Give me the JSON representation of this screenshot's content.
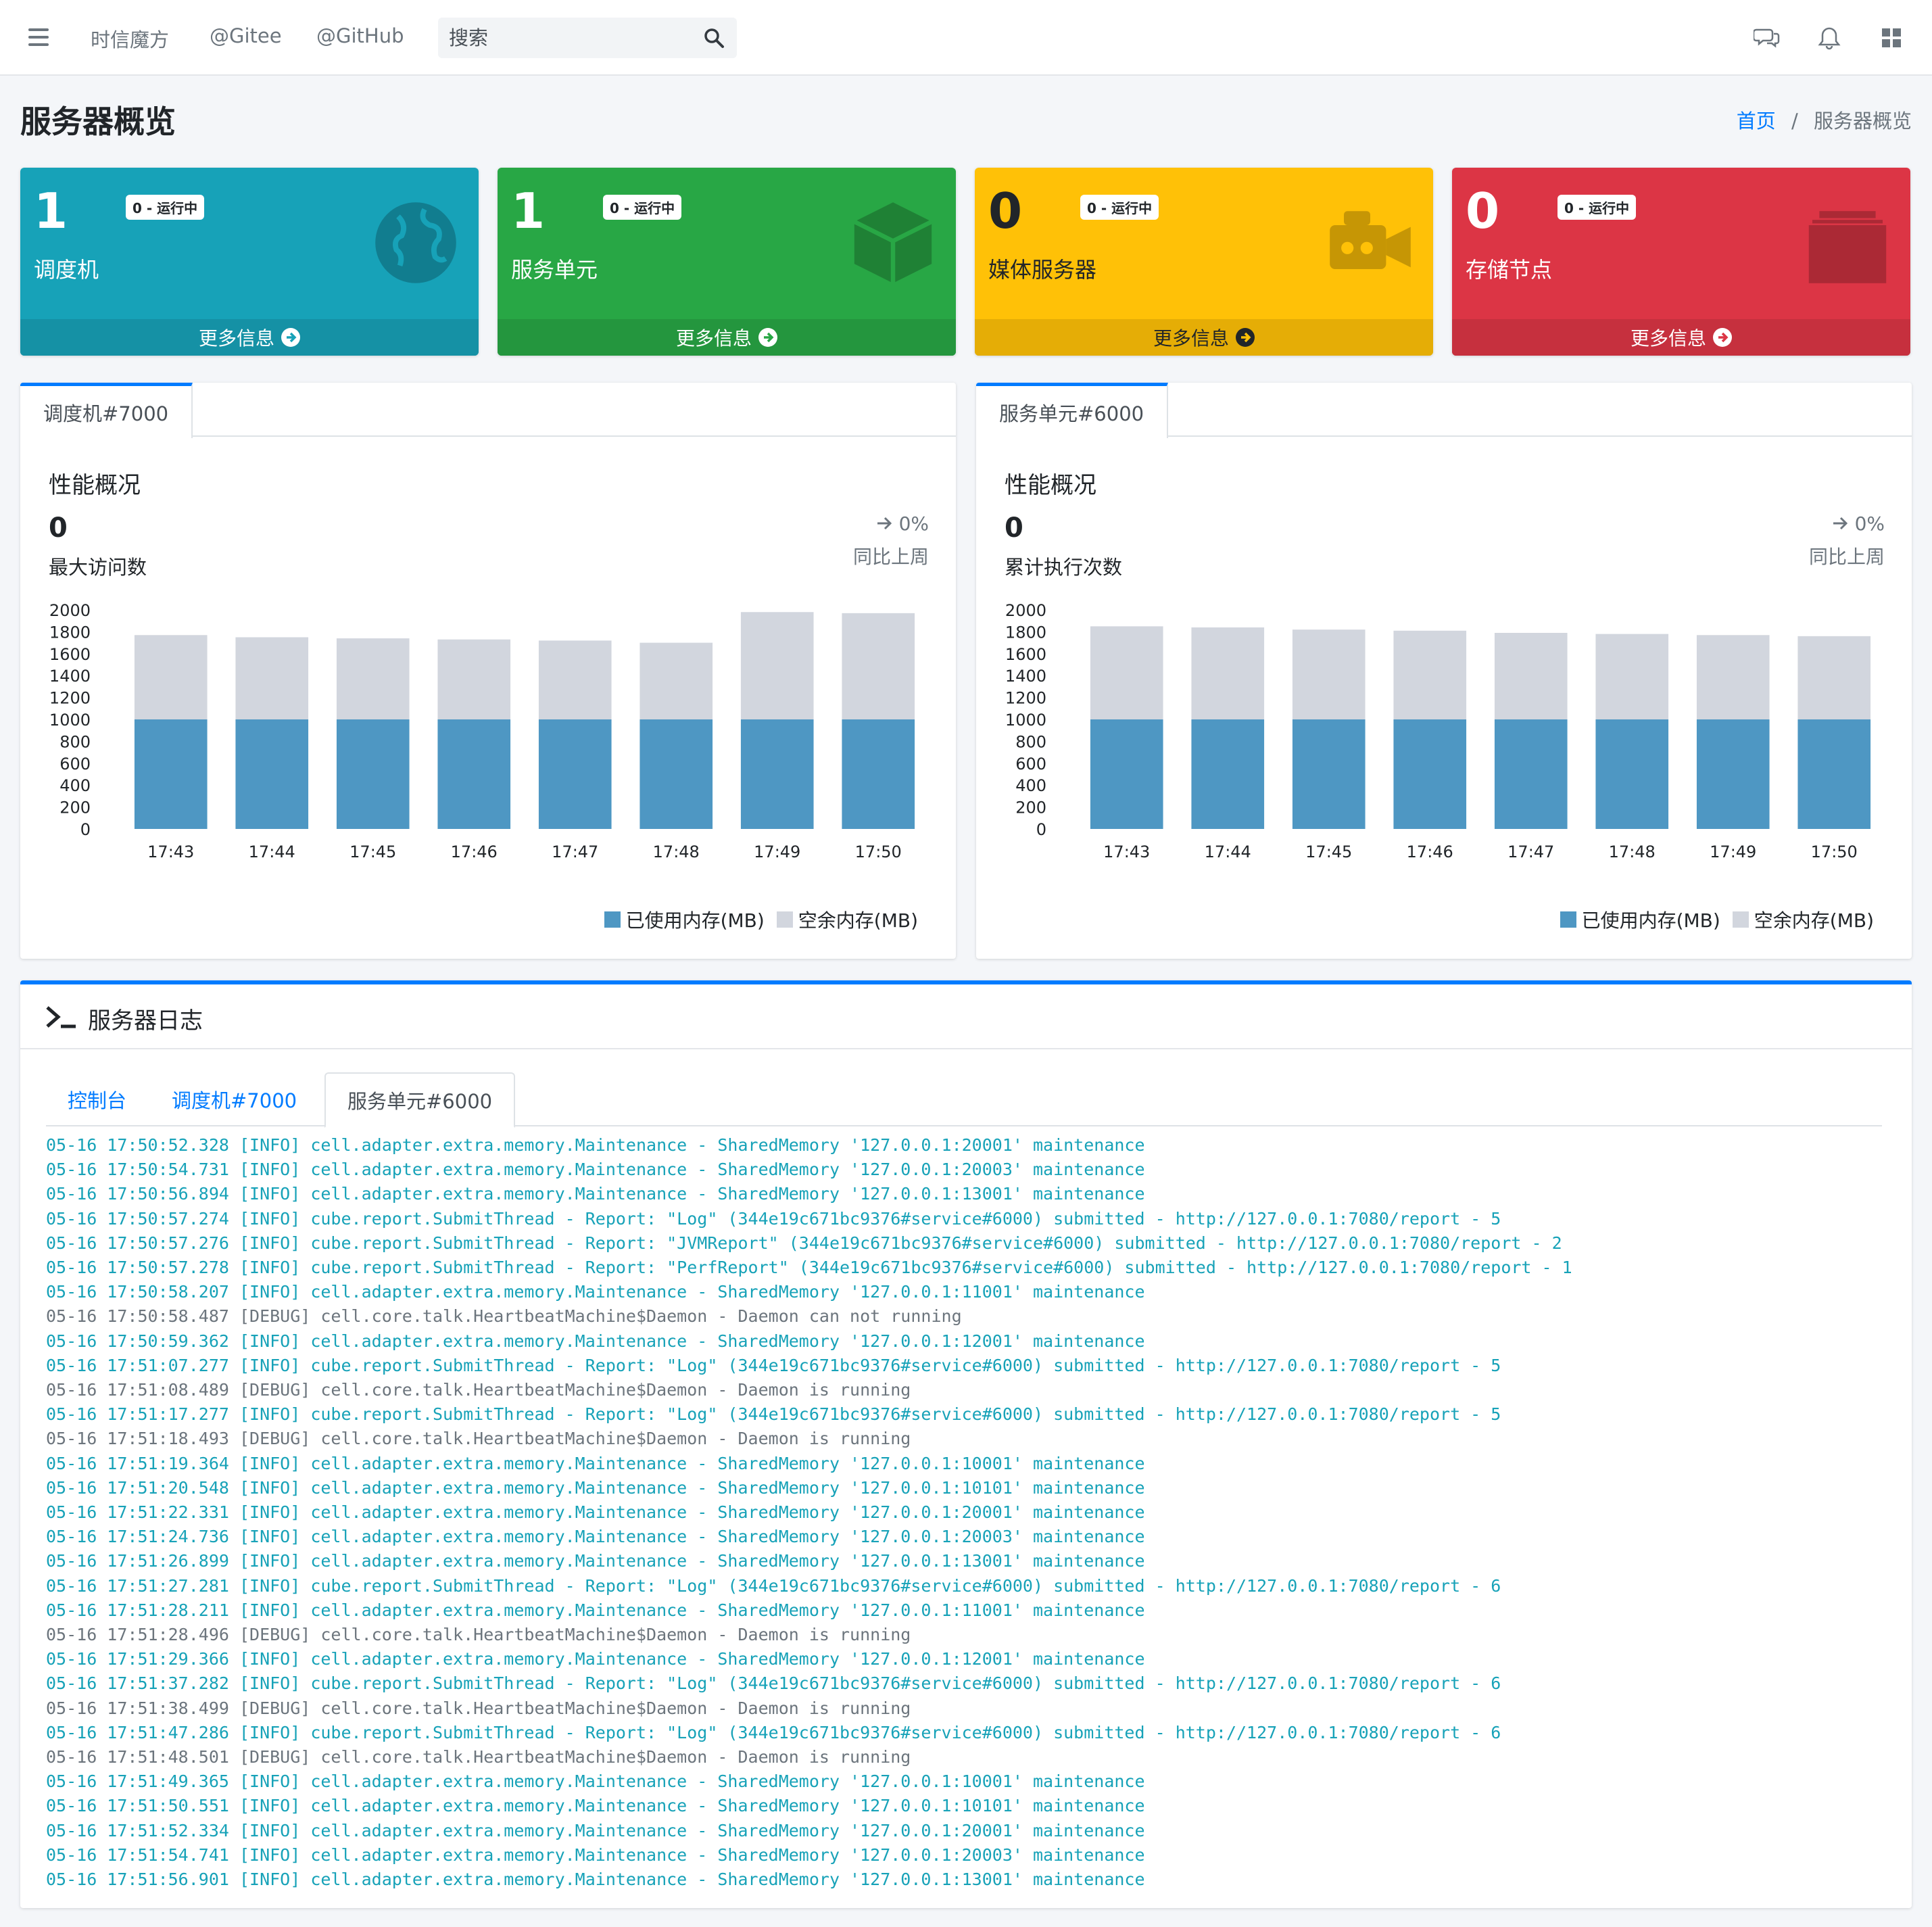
{
  "navbar": {
    "links": [
      "时信魔方",
      "@Gitee",
      "@GitHub"
    ],
    "search_placeholder": "搜索",
    "icons": [
      "menu-icon",
      "search-icon",
      "chat-icon",
      "bell-icon",
      "apps-grid-icon"
    ]
  },
  "page": {
    "title": "服务器概览",
    "breadcrumb": [
      "首页",
      "/",
      "服务器概览"
    ]
  },
  "stats": [
    {
      "count": "1",
      "badge": "0 - 运行中",
      "label": "调度机",
      "footer": "更多信息",
      "color": "#17a2b8",
      "footer_color": "#1591a5",
      "icon": "globe-icon"
    },
    {
      "count": "1",
      "badge": "0 - 运行中",
      "label": "服务单元",
      "footer": "更多信息",
      "color": "#28a745",
      "footer_color": "#24963e",
      "icon": "cube-icon"
    },
    {
      "count": "0",
      "badge": "0 - 运行中",
      "label": "媒体服务器",
      "footer": "更多信息",
      "color": "#ffc107",
      "footer_color": "#e5ad06",
      "icon": "video-camera-icon"
    },
    {
      "count": "0",
      "badge": "0 - 运行中",
      "label": "存储节点",
      "footer": "更多信息",
      "color": "#dc3545",
      "footer_color": "#c6303e",
      "icon": "archive-icon"
    }
  ],
  "panels": [
    {
      "tab": "调度机#7000",
      "title": "性能概况",
      "value": "0",
      "value_label": "最大访问数",
      "change": "0%",
      "change_label": "同比上周"
    },
    {
      "tab": "服务单元#6000",
      "title": "性能概况",
      "value": "0",
      "value_label": "累计执行次数",
      "change": "0%",
      "change_label": "同比上周"
    }
  ],
  "chart_data": [
    {
      "type": "bar",
      "stacked": true,
      "categories": [
        "17:43",
        "17:44",
        "17:45",
        "17:46",
        "17:47",
        "17:48",
        "17:49",
        "17:50"
      ],
      "series": [
        {
          "name": "已使用内存(MB)",
          "color": "#4e97c3",
          "values": [
            1000,
            1000,
            1000,
            1000,
            1000,
            1000,
            1000,
            1000
          ]
        },
        {
          "name": "空余内存(MB)",
          "color": "#d2d6de",
          "values": [
            770,
            750,
            740,
            730,
            720,
            700,
            980,
            970
          ]
        }
      ],
      "ylim": [
        0,
        2000
      ],
      "yticks": [
        0,
        200,
        400,
        600,
        800,
        1000,
        1200,
        1400,
        1600,
        1800,
        2000
      ],
      "legend": "bottom-right"
    },
    {
      "type": "bar",
      "stacked": true,
      "categories": [
        "17:43",
        "17:44",
        "17:45",
        "17:46",
        "17:47",
        "17:48",
        "17:49",
        "17:50"
      ],
      "series": [
        {
          "name": "已使用内存(MB)",
          "color": "#4e97c3",
          "values": [
            1000,
            1000,
            1000,
            1000,
            1000,
            1000,
            1000,
            1000
          ]
        },
        {
          "name": "空余内存(MB)",
          "color": "#d2d6de",
          "values": [
            850,
            840,
            820,
            810,
            790,
            780,
            770,
            760
          ]
        }
      ],
      "ylim": [
        0,
        2000
      ],
      "yticks": [
        0,
        200,
        400,
        600,
        800,
        1000,
        1200,
        1400,
        1600,
        1800,
        2000
      ],
      "legend": "bottom-right"
    }
  ],
  "log": {
    "title": "服务器日志",
    "tabs": [
      "控制台",
      "调度机#7000",
      "服务单元#6000"
    ],
    "active_tab": "服务单元#6000",
    "lines": [
      {
        "level": "info",
        "text": "05-16 17:50:52.328 [INFO] cell.adapter.extra.memory.Maintenance - SharedMemory '127.0.0.1:20001' maintenance"
      },
      {
        "level": "info",
        "text": "05-16 17:50:54.731 [INFO] cell.adapter.extra.memory.Maintenance - SharedMemory '127.0.0.1:20003' maintenance"
      },
      {
        "level": "info",
        "text": "05-16 17:50:56.894 [INFO] cell.adapter.extra.memory.Maintenance - SharedMemory '127.0.0.1:13001' maintenance"
      },
      {
        "level": "info",
        "text": "05-16 17:50:57.274 [INFO] cube.report.SubmitThread - Report: \"Log\" (344e19c671bc9376#service#6000) submitted - http://127.0.0.1:7080/report - 5"
      },
      {
        "level": "info",
        "text": "05-16 17:50:57.276 [INFO] cube.report.SubmitThread - Report: \"JVMReport\" (344e19c671bc9376#service#6000) submitted - http://127.0.0.1:7080/report - 2"
      },
      {
        "level": "info",
        "text": "05-16 17:50:57.278 [INFO] cube.report.SubmitThread - Report: \"PerfReport\" (344e19c671bc9376#service#6000) submitted - http://127.0.0.1:7080/report - 1"
      },
      {
        "level": "info",
        "text": "05-16 17:50:58.207 [INFO] cell.adapter.extra.memory.Maintenance - SharedMemory '127.0.0.1:11001' maintenance"
      },
      {
        "level": "debug",
        "text": "05-16 17:50:58.487 [DEBUG] cell.core.talk.HeartbeatMachine$Daemon - Daemon can not running"
      },
      {
        "level": "info",
        "text": "05-16 17:50:59.362 [INFO] cell.adapter.extra.memory.Maintenance - SharedMemory '127.0.0.1:12001' maintenance"
      },
      {
        "level": "info",
        "text": "05-16 17:51:07.277 [INFO] cube.report.SubmitThread - Report: \"Log\" (344e19c671bc9376#service#6000) submitted - http://127.0.0.1:7080/report - 5"
      },
      {
        "level": "debug",
        "text": "05-16 17:51:08.489 [DEBUG] cell.core.talk.HeartbeatMachine$Daemon - Daemon is running"
      },
      {
        "level": "info",
        "text": "05-16 17:51:17.277 [INFO] cube.report.SubmitThread - Report: \"Log\" (344e19c671bc9376#service#6000) submitted - http://127.0.0.1:7080/report - 5"
      },
      {
        "level": "debug",
        "text": "05-16 17:51:18.493 [DEBUG] cell.core.talk.HeartbeatMachine$Daemon - Daemon is running"
      },
      {
        "level": "info",
        "text": "05-16 17:51:19.364 [INFO] cell.adapter.extra.memory.Maintenance - SharedMemory '127.0.0.1:10001' maintenance"
      },
      {
        "level": "info",
        "text": "05-16 17:51:20.548 [INFO] cell.adapter.extra.memory.Maintenance - SharedMemory '127.0.0.1:10101' maintenance"
      },
      {
        "level": "info",
        "text": "05-16 17:51:22.331 [INFO] cell.adapter.extra.memory.Maintenance - SharedMemory '127.0.0.1:20001' maintenance"
      },
      {
        "level": "info",
        "text": "05-16 17:51:24.736 [INFO] cell.adapter.extra.memory.Maintenance - SharedMemory '127.0.0.1:20003' maintenance"
      },
      {
        "level": "info",
        "text": "05-16 17:51:26.899 [INFO] cell.adapter.extra.memory.Maintenance - SharedMemory '127.0.0.1:13001' maintenance"
      },
      {
        "level": "info",
        "text": "05-16 17:51:27.281 [INFO] cube.report.SubmitThread - Report: \"Log\" (344e19c671bc9376#service#6000) submitted - http://127.0.0.1:7080/report - 6"
      },
      {
        "level": "info",
        "text": "05-16 17:51:28.211 [INFO] cell.adapter.extra.memory.Maintenance - SharedMemory '127.0.0.1:11001' maintenance"
      },
      {
        "level": "debug",
        "text": "05-16 17:51:28.496 [DEBUG] cell.core.talk.HeartbeatMachine$Daemon - Daemon is running"
      },
      {
        "level": "info",
        "text": "05-16 17:51:29.366 [INFO] cell.adapter.extra.memory.Maintenance - SharedMemory '127.0.0.1:12001' maintenance"
      },
      {
        "level": "info",
        "text": "05-16 17:51:37.282 [INFO] cube.report.SubmitThread - Report: \"Log\" (344e19c671bc9376#service#6000) submitted - http://127.0.0.1:7080/report - 6"
      },
      {
        "level": "debug",
        "text": "05-16 17:51:38.499 [DEBUG] cell.core.talk.HeartbeatMachine$Daemon - Daemon is running"
      },
      {
        "level": "info",
        "text": "05-16 17:51:47.286 [INFO] cube.report.SubmitThread - Report: \"Log\" (344e19c671bc9376#service#6000) submitted - http://127.0.0.1:7080/report - 6"
      },
      {
        "level": "debug",
        "text": "05-16 17:51:48.501 [DEBUG] cell.core.talk.HeartbeatMachine$Daemon - Daemon is running"
      },
      {
        "level": "info",
        "text": "05-16 17:51:49.365 [INFO] cell.adapter.extra.memory.Maintenance - SharedMemory '127.0.0.1:10001' maintenance"
      },
      {
        "level": "info",
        "text": "05-16 17:51:50.551 [INFO] cell.adapter.extra.memory.Maintenance - SharedMemory '127.0.0.1:10101' maintenance"
      },
      {
        "level": "info",
        "text": "05-16 17:51:52.334 [INFO] cell.adapter.extra.memory.Maintenance - SharedMemory '127.0.0.1:20001' maintenance"
      },
      {
        "level": "info",
        "text": "05-16 17:51:54.741 [INFO] cell.adapter.extra.memory.Maintenance - SharedMemory '127.0.0.1:20003' maintenance"
      },
      {
        "level": "info",
        "text": "05-16 17:51:56.901 [INFO] cell.adapter.extra.memory.Maintenance - SharedMemory '127.0.0.1:13001' maintenance"
      }
    ]
  }
}
